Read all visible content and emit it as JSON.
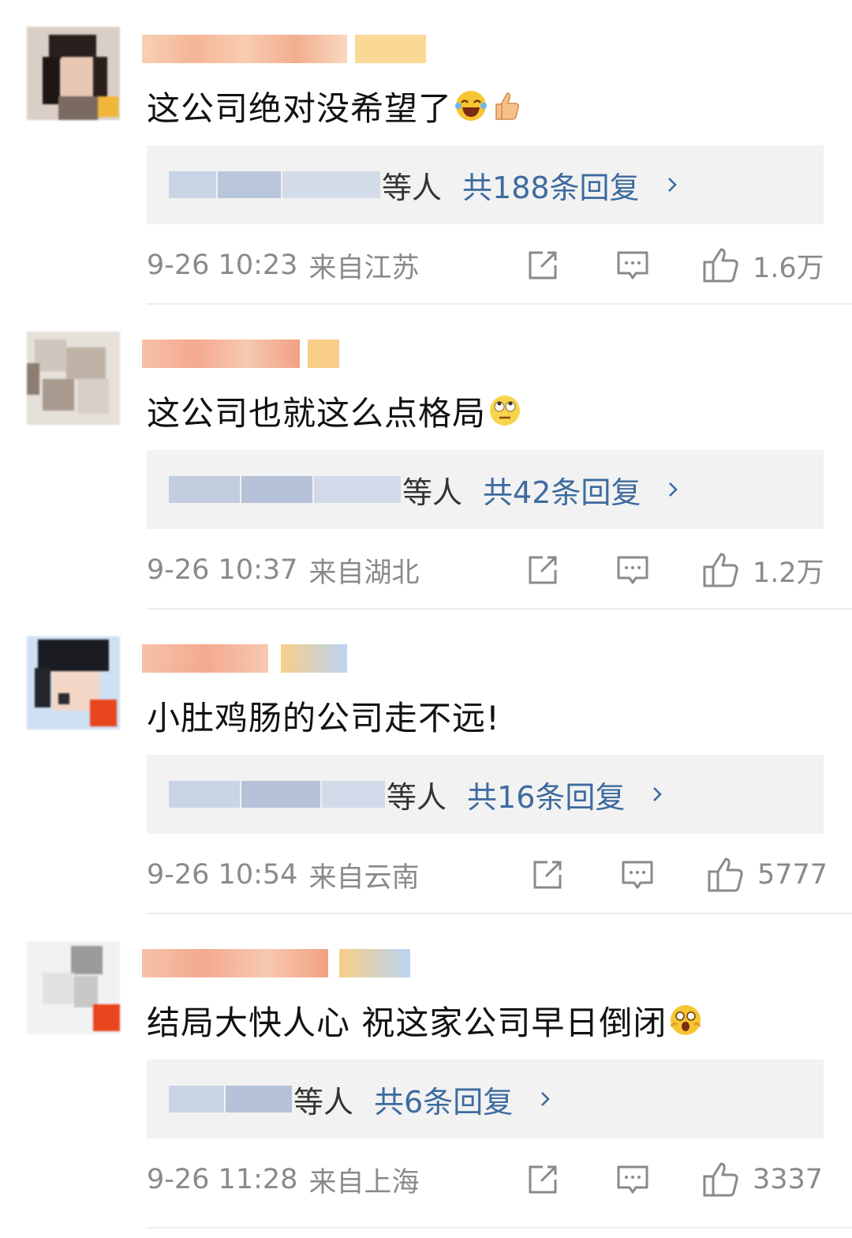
{
  "comments": [
    {
      "text": "这公司绝对没希望了",
      "reply_suffix": "等人",
      "reply_total": "共188条回复",
      "time": "9-26 10:23",
      "location": "来自江苏",
      "likes": "1.6万"
    },
    {
      "text": "这公司也就这么点格局",
      "reply_suffix": "等人",
      "reply_total": "共42条回复",
      "time": "9-26 10:37",
      "location": "来自湖北",
      "likes": "1.2万"
    },
    {
      "text": "小肚鸡肠的公司走不远!",
      "reply_suffix": "等人",
      "reply_total": "共16条回复",
      "time": "9-26 10:54",
      "location": "来自云南",
      "likes": "5777"
    },
    {
      "text": "结局大快人心 祝这家公司早日倒闭",
      "reply_suffix": "等人",
      "reply_total": "共6条回复",
      "time": "9-26 11:28",
      "location": "来自上海",
      "likes": "3337"
    }
  ],
  "colors": {
    "link_blue": "#3d6b9f",
    "meta_gray": "#8a8a8a",
    "reply_bg": "#f2f2f2"
  },
  "icons": {
    "share": "share-icon",
    "comment": "comment-icon",
    "like": "thumbs-up-icon",
    "chevron": "chevron-right-icon"
  }
}
